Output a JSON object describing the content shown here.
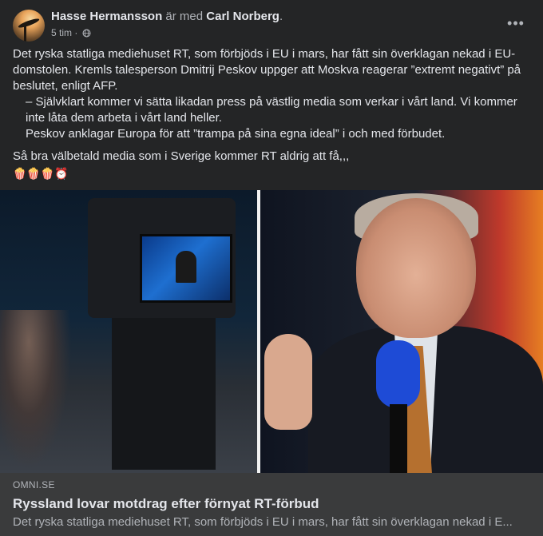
{
  "post": {
    "author": "Hasse Hermansson",
    "connector": " är med ",
    "tagged": "Carl Norberg",
    "period": ".",
    "time": "5 tim",
    "dot": " · ",
    "more_label": "•••",
    "paragraphs": [
      "Det ryska statliga mediehuset RT, som förbjöds i EU i mars, har fått sin överklagan nekad i EU-domstolen. Kremls talesperson Dmitrij Peskov uppger att Moskva reagerar ”extremt negativt” på beslutet, enligt AFP.",
      "– Självklart kommer vi sätta likadan press på västlig media som verkar i vårt land. Vi kommer inte låta dem arbeta i vårt land heller.",
      "Peskov anklagar Europa för att ”trampa på sina egna ideal” i och med förbudet.",
      "Så bra välbetald media som i Sverige kommer RT aldrig att få,,,"
    ],
    "emojis": "🍿🍿🍿⏰"
  },
  "link": {
    "domain": "OMNI.SE",
    "title": "Ryssland lovar motdrag efter förnyat RT-förbud",
    "description": "Det ryska statliga mediehuset RT, som förbjöds i EU i mars, har fått sin överklagan nekad i E..."
  },
  "icons": {
    "privacy": "globe-icon",
    "menu": "more-options-icon"
  }
}
